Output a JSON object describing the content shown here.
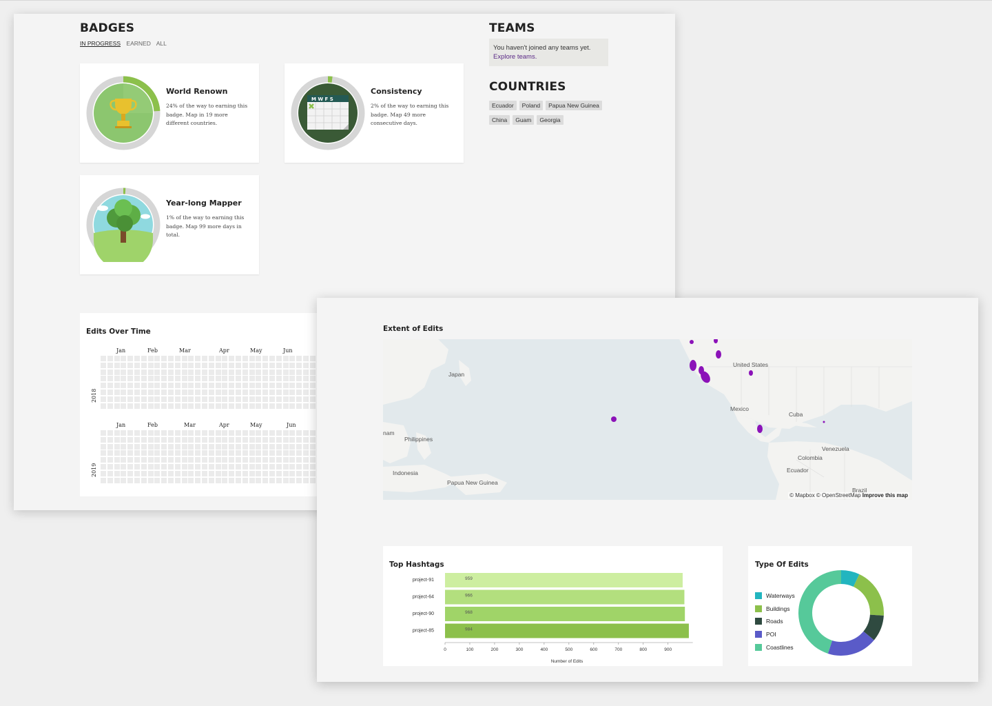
{
  "badges": {
    "heading": "BADGES",
    "tabs": [
      "IN PROGRESS",
      "EARNED",
      "ALL"
    ],
    "items": [
      {
        "title": "World Renown",
        "desc": "24% of the way to earning this badge. Map in 19 more different countries.",
        "progress": 0.24,
        "icon": "trophy-icon"
      },
      {
        "title": "Consistency",
        "desc": "2% of the way to earning this badge. Map 49 more consecutive days.",
        "progress": 0.02,
        "icon": "calendar-icon"
      },
      {
        "title": "Year-long Mapper",
        "desc": "1% of the way to earning this badge. Map 99 more days in total.",
        "progress": 0.01,
        "icon": "tree-icon"
      }
    ]
  },
  "teams": {
    "heading": "TEAMS",
    "message": "You haven't joined any teams yet.",
    "link": "Explore teams."
  },
  "countries": {
    "heading": "COUNTRIES",
    "tags": [
      "Ecuador",
      "Poland",
      "Papua New Guinea",
      "China",
      "Guam",
      "Georgia"
    ]
  },
  "edits_over_time": {
    "title": "Edits Over Time",
    "years": [
      {
        "year": "2018",
        "months": [
          "Jan",
          "Feb",
          "Mar",
          "Apr",
          "May",
          "Jun"
        ]
      },
      {
        "year": "2019",
        "months": [
          "Jan",
          "Feb",
          "Mar",
          "Apr",
          "May",
          "Jun"
        ]
      }
    ]
  },
  "map": {
    "title": "Extent of Edits",
    "labels": [
      "Japan",
      "United States",
      "Mexico",
      "Cuba",
      "nam",
      "Philippines",
      "Venezuela",
      "Colombia",
      "Ecuador",
      "Indonesia",
      "Papua New Guinea",
      "Brazil"
    ],
    "attribution": "© Mapbox © OpenStreetMap",
    "improve": "Improve this map",
    "highlight_color": "#8b12b8"
  },
  "top_hashtags": {
    "title": "Top Hashtags",
    "xlabel": "Number of Edits"
  },
  "type_of_edits": {
    "title": "Type Of Edits",
    "legend": [
      {
        "name": "Waterways",
        "color": "#22b5bf"
      },
      {
        "name": "Buildings",
        "color": "#8cc04b"
      },
      {
        "name": "Roads",
        "color": "#2f4a40"
      },
      {
        "name": "POI",
        "color": "#5a5bc8"
      },
      {
        "name": "Coastlines",
        "color": "#56c99a"
      }
    ]
  },
  "chart_data": [
    {
      "type": "bar",
      "orientation": "horizontal",
      "title": "Top Hashtags",
      "categories": [
        "project-91",
        "project-64",
        "project-90",
        "project-85"
      ],
      "values": [
        959,
        966,
        968,
        984
      ],
      "xlabel": "Number of Edits",
      "ylabel": "",
      "xlim": [
        0,
        1000
      ],
      "xticks": [
        0,
        100,
        200,
        300,
        400,
        500,
        600,
        700,
        800,
        900
      ],
      "colors": [
        "#cdeea0",
        "#b3df7e",
        "#a0d468",
        "#8cc04b"
      ],
      "grid": false
    },
    {
      "type": "pie",
      "variant": "donut",
      "title": "Type Of Edits",
      "categories": [
        "Waterways",
        "Buildings",
        "Roads",
        "POI",
        "Coastlines"
      ],
      "values": [
        7,
        19,
        10,
        19,
        45
      ],
      "colors": [
        "#22b5bf",
        "#8cc04b",
        "#2f4a40",
        "#5a5bc8",
        "#56c99a"
      ],
      "legend": "left"
    }
  ]
}
